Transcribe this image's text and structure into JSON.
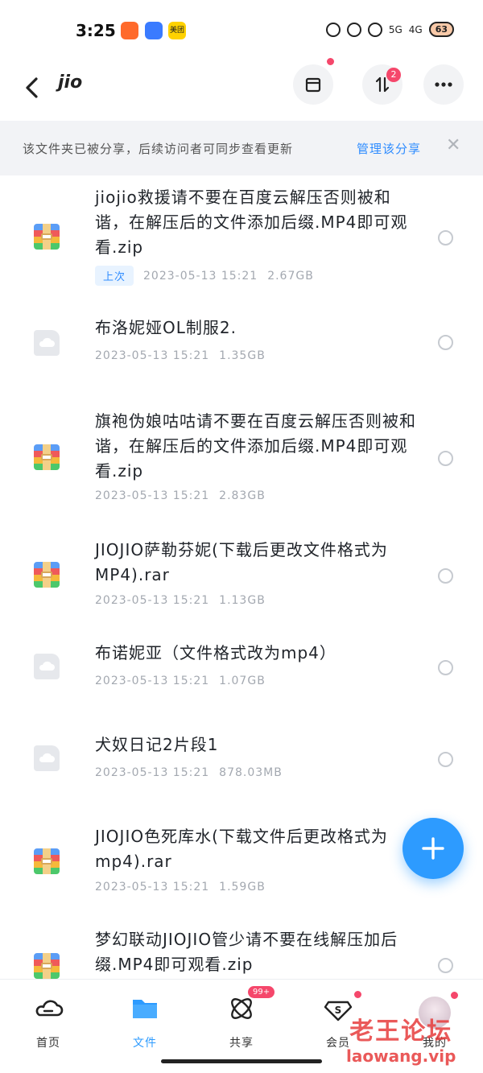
{
  "status_bar": {
    "time": "3:25",
    "app_badges": [
      {
        "icon": "app-badge-orange",
        "color": "#ff6a2b"
      },
      {
        "icon": "app-badge-blue",
        "color": "#3a7bff"
      },
      {
        "icon": "app-badge-meituan",
        "color": "#ffd200",
        "text": "美团"
      }
    ],
    "network_1": "5G",
    "network_2": "4G",
    "battery": "63"
  },
  "header": {
    "title": "jio",
    "transfer_count": "2"
  },
  "notice": {
    "text": "该文件夹已被分享，后续访问者可同步查看更新",
    "link": "管理该分享",
    "close": "✕"
  },
  "files": [
    {
      "title": "jiojio救援请不要在百度云解压否则被和谐，在解压后的文件添加后缀.MP4即可观看.zip",
      "tag": "上次",
      "date": "2023-05-13  15:21",
      "size": "2.67GB",
      "type": "zip"
    },
    {
      "title": "布洛妮娅OL制服2.",
      "date": "2023-05-13  15:21",
      "size": "1.35GB",
      "type": "file"
    },
    {
      "title": "旗袍伪娘咕咕请不要在百度云解压否则被和谐，在解压后的文件添加后缀.MP4即可观看.zip",
      "date": "2023-05-13  15:21",
      "size": "2.83GB",
      "type": "zip"
    },
    {
      "title": "JIOJIO萨勒芬妮(下载后更改文件格式为MP4).rar",
      "date": "2023-05-13  15:21",
      "size": "1.13GB",
      "type": "zip"
    },
    {
      "title": "布诺妮亚（文件格式改为mp4）",
      "date": "2023-05-13  15:21",
      "size": "1.07GB",
      "type": "file"
    },
    {
      "title": "犬奴日记2片段1",
      "date": "2023-05-13  15:21",
      "size": "878.03MB",
      "type": "file"
    },
    {
      "title": "JIOJIO色死库水(下载文件后更改格式为mp4).rar",
      "date": "2023-05-13  15:21",
      "size": "1.59GB",
      "type": "zip"
    },
    {
      "title": "梦幻联动JIOJIO管少请不要在线解压加后缀.MP4即可观看.zip",
      "type": "zip"
    }
  ],
  "nav": {
    "items": [
      {
        "label": "首页"
      },
      {
        "label": "文件"
      },
      {
        "label": "共享",
        "badge": "99+"
      },
      {
        "label": "会员"
      },
      {
        "label": "我的"
      }
    ]
  },
  "watermark": {
    "line1": "老王论坛",
    "line2": "laowang.vip"
  },
  "colors": {
    "accent": "#2d9bff",
    "badge": "#f5476b",
    "notice_bg": "#f2f3f6"
  }
}
